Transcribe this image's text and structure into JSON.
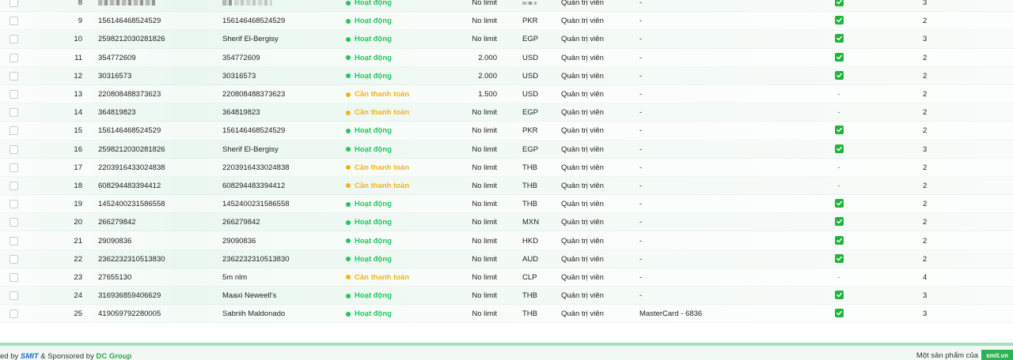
{
  "rows": [
    {
      "idx": "8",
      "id": "",
      "name": "",
      "blurred": true,
      "status": "Hoạt động",
      "status_type": "active",
      "limit": "No limit",
      "currency": "",
      "role": "Quản trị viên",
      "card": "-",
      "flag": "check",
      "count": "3"
    },
    {
      "idx": "9",
      "id": "156146468524529",
      "name": "156146468524529",
      "status": "Hoạt động",
      "status_type": "active",
      "limit": "No limit",
      "currency": "PKR",
      "role": "Quản trị viên",
      "card": "-",
      "flag": "check",
      "count": "2"
    },
    {
      "idx": "10",
      "id": "2598212030281826",
      "name": "Sherif El-Bergisy",
      "status": "Hoạt động",
      "status_type": "active",
      "limit": "No limit",
      "currency": "EGP",
      "role": "Quản trị viên",
      "card": "-",
      "flag": "check",
      "count": "3"
    },
    {
      "idx": "11",
      "id": "354772609",
      "name": "354772609",
      "status": "Hoạt động",
      "status_type": "active",
      "limit": "2.000",
      "currency": "USD",
      "role": "Quản trị viên",
      "card": "-",
      "flag": "check",
      "count": "2"
    },
    {
      "idx": "12",
      "id": "30316573",
      "name": "30316573",
      "status": "Hoạt động",
      "status_type": "active",
      "limit": "2.000",
      "currency": "USD",
      "role": "Quản trị viên",
      "card": "-",
      "flag": "check",
      "count": "2"
    },
    {
      "idx": "13",
      "id": "220808488373623",
      "name": "220808488373623",
      "status": "Cần thanh toán",
      "status_type": "pay",
      "limit": "1.500",
      "currency": "USD",
      "role": "Quản trị viên",
      "card": "-",
      "flag": "-",
      "count": "2"
    },
    {
      "idx": "14",
      "id": "364819823",
      "name": "364819823",
      "status": "Cần thanh toán",
      "status_type": "pay",
      "limit": "No limit",
      "currency": "EGP",
      "role": "Quản trị viên",
      "card": "-",
      "flag": "-",
      "count": "2"
    },
    {
      "idx": "15",
      "id": "156146468524529",
      "name": "156146468524529",
      "status": "Hoạt động",
      "status_type": "active",
      "limit": "No limit",
      "currency": "PKR",
      "role": "Quản trị viên",
      "card": "-",
      "flag": "check",
      "count": "2"
    },
    {
      "idx": "16",
      "id": "2598212030281826",
      "name": "Sherif El-Bergisy",
      "status": "Hoạt động",
      "status_type": "active",
      "limit": "No limit",
      "currency": "EGP",
      "role": "Quản trị viên",
      "card": "-",
      "flag": "check",
      "count": "3"
    },
    {
      "idx": "17",
      "id": "2203916433024838",
      "name": "2203916433024838",
      "status": "Cần thanh toán",
      "status_type": "pay",
      "limit": "No limit",
      "currency": "THB",
      "role": "Quản trị viên",
      "card": "-",
      "flag": "-",
      "count": "2"
    },
    {
      "idx": "18",
      "id": "608294483394412",
      "name": "608294483394412",
      "status": "Cần thanh toán",
      "status_type": "pay",
      "limit": "No limit",
      "currency": "THB",
      "role": "Quản trị viên",
      "card": "-",
      "flag": "-",
      "count": "2"
    },
    {
      "idx": "19",
      "id": "1452400231586558",
      "name": "1452400231586558",
      "status": "Hoạt động",
      "status_type": "active",
      "limit": "No limit",
      "currency": "THB",
      "role": "Quản trị viên",
      "card": "-",
      "flag": "check",
      "count": "2"
    },
    {
      "idx": "20",
      "id": "266279842",
      "name": "266279842",
      "status": "Hoạt động",
      "status_type": "active",
      "limit": "No limit",
      "currency": "MXN",
      "role": "Quản trị viên",
      "card": "-",
      "flag": "check",
      "count": "2"
    },
    {
      "idx": "21",
      "id": "29090836",
      "name": "29090836",
      "status": "Hoạt động",
      "status_type": "active",
      "limit": "No limit",
      "currency": "HKD",
      "role": "Quản trị viên",
      "card": "-",
      "flag": "check",
      "count": "2"
    },
    {
      "idx": "22",
      "id": "2362232310513830",
      "name": "2362232310513830",
      "status": "Hoạt động",
      "status_type": "active",
      "limit": "No limit",
      "currency": "AUD",
      "role": "Quản trị viên",
      "card": "-",
      "flag": "check",
      "count": "2"
    },
    {
      "idx": "23",
      "id": "27655130",
      "name": "5m nlm",
      "status": "Cần thanh toán",
      "status_type": "pay",
      "limit": "No limit",
      "currency": "CLP",
      "role": "Quản trị viên",
      "card": "-",
      "flag": "-",
      "count": "4"
    },
    {
      "idx": "24",
      "id": "316936859406629",
      "name": "Maaxi Neweell's",
      "status": "Hoạt động",
      "status_type": "active",
      "limit": "No limit",
      "currency": "THB",
      "role": "Quản trị viên",
      "card": "-",
      "flag": "check",
      "count": "3"
    },
    {
      "idx": "25",
      "id": "419059792280005",
      "name": "Sabriih Maldonado",
      "status": "Hoạt động",
      "status_type": "active",
      "limit": "No limit",
      "currency": "THB",
      "role": "Quản trị viên",
      "card": "MasterCard - 6836",
      "flag": "check",
      "count": "3"
    }
  ],
  "footer": {
    "left_prefix": "ed by",
    "smit": "SMIT",
    "sponsor_text": "& Sponsored by",
    "dc_group": "DC Group",
    "right_text": "Một sản phẩm của",
    "brand": "smit.vn"
  },
  "colors": {
    "active": "#22c55e",
    "pay": "#f5b21a",
    "check": "#22b33e"
  }
}
